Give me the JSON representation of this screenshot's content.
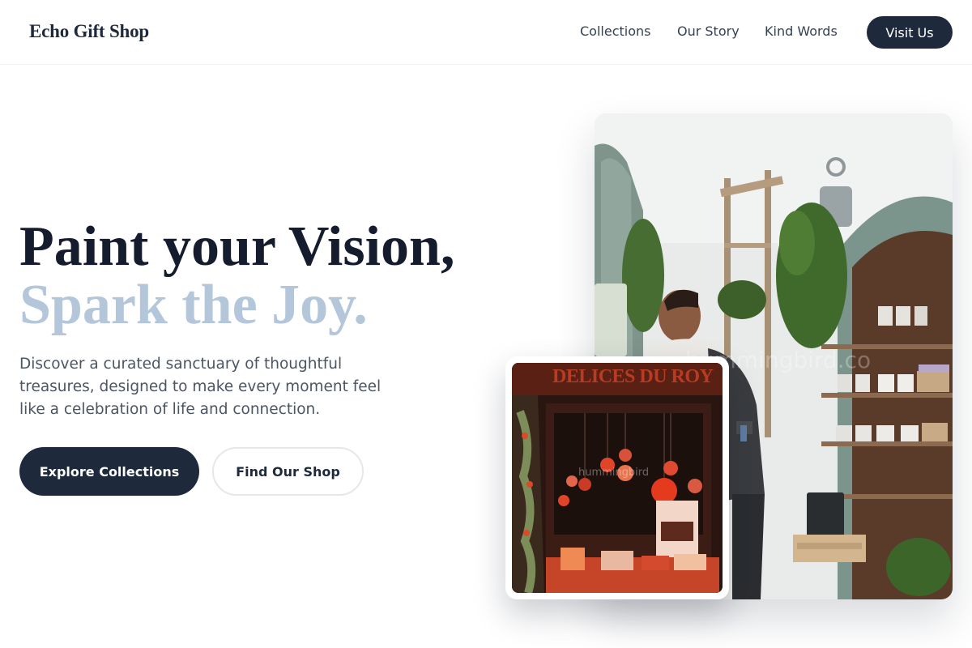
{
  "header": {
    "brand": "Echo Gift Shop",
    "nav": [
      "Collections",
      "Our Story",
      "Kind Words"
    ],
    "cta": "Visit Us"
  },
  "hero": {
    "title_line1": "Paint your Vision,",
    "title_line2": "Spark the Joy.",
    "description": "Discover a curated sanctuary of thoughtful treasures, designed to make every moment feel like a celebration of life and connection.",
    "primary_button": "Explore Collections",
    "secondary_button": "Find Our Shop"
  },
  "images": {
    "main_watermark": "hummingbird.co",
    "inset_sign": "DELICES DU ROY",
    "inset_watermark": "hummingbird"
  },
  "colors": {
    "navy": "#1e293b",
    "accent_light_blue": "#b4c6d9",
    "text_gray": "#4b5563",
    "border": "#e5e7eb"
  }
}
